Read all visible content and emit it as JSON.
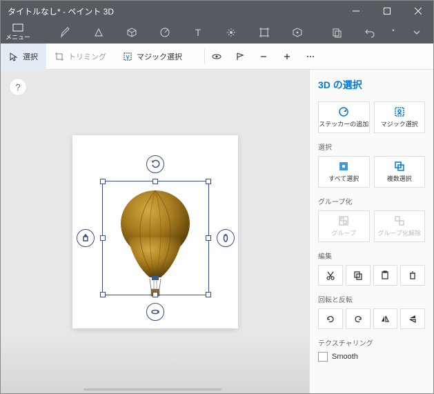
{
  "titlebar": {
    "title": "タイトルなし* - ペイント 3D"
  },
  "menu": {
    "label": "メニュー"
  },
  "secondary": {
    "select_label": "選択",
    "trim_label": "トリミング",
    "magic_label": "マジック選択"
  },
  "panel": {
    "title": "3D の選択",
    "sticker_label": "ステッカーの追加",
    "magic_label": "マジック選択",
    "section_select": "選択",
    "select_all": "すべて選択",
    "multi_select": "複数選択",
    "section_group": "グループ化",
    "group": "グループ",
    "ungroup": "グループ化解除",
    "section_edit": "編集",
    "section_rotate": "回転と反転",
    "section_texture": "テクスチャリング",
    "smooth": "Smooth"
  },
  "help": {
    "label": "?"
  }
}
